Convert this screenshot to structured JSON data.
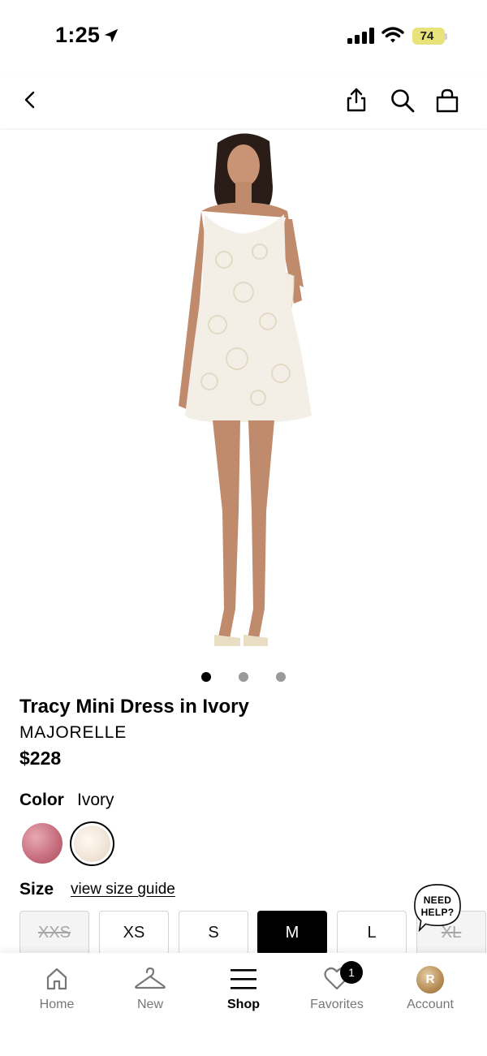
{
  "status_bar": {
    "time": "1:25",
    "battery": "74"
  },
  "product": {
    "title": "Tracy Mini Dress in Ivory",
    "brand": "MAJORELLE",
    "price": "$228",
    "image_count": 3,
    "current_image": 1
  },
  "color": {
    "label": "Color",
    "selected": "Ivory"
  },
  "size": {
    "label": "Size",
    "guide_link": "view size guide",
    "options": [
      {
        "label": "XXS",
        "available": false
      },
      {
        "label": "XS",
        "available": true
      },
      {
        "label": "S",
        "available": true
      },
      {
        "label": "M",
        "available": true,
        "selected": true
      },
      {
        "label": "L",
        "available": true
      },
      {
        "label": "XL",
        "available": false
      }
    ]
  },
  "help": {
    "line1": "NEED",
    "line2": "HELP?"
  },
  "tabs": [
    {
      "label": "Home",
      "icon": "home-icon"
    },
    {
      "label": "New",
      "icon": "hanger-icon"
    },
    {
      "label": "Shop",
      "icon": "menu-icon",
      "active": true
    },
    {
      "label": "Favorites",
      "icon": "heart-icon",
      "badge": "1"
    },
    {
      "label": "Account",
      "icon": "avatar",
      "avatar_initial": "R"
    }
  ],
  "colors": {
    "accent": "#000000",
    "battery": "#e7e27a",
    "inactive_tab": "#777777"
  }
}
